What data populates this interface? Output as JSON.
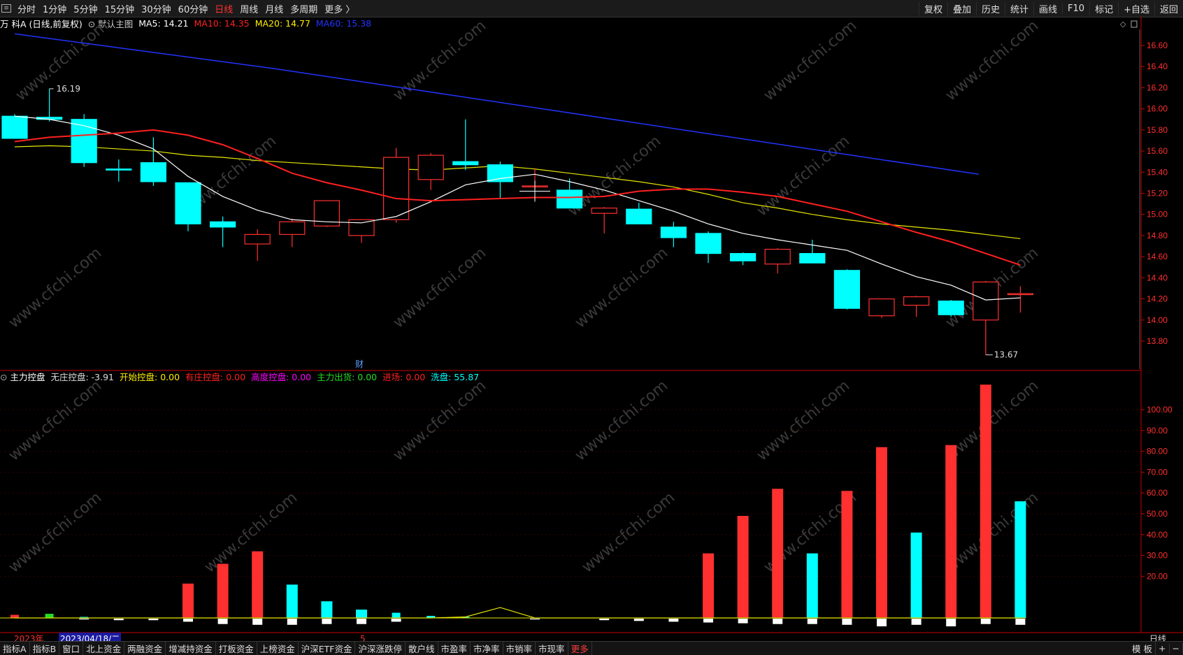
{
  "toolbar": {
    "periods": [
      "分时",
      "1分钟",
      "5分钟",
      "15分钟",
      "30分钟",
      "60分钟",
      "日线",
      "周线",
      "月线",
      "多周期",
      "更多 〉"
    ],
    "selected_period": "日线",
    "right_buttons": [
      "复权",
      "叠加",
      "历史",
      "统计",
      "画线",
      "F10",
      "标记",
      "+自选",
      "返回"
    ]
  },
  "main_header": {
    "stock": "万 科A (日线,前复权)",
    "main_chart": "默认主图",
    "ma": [
      {
        "label": "MA5: 14.21",
        "color": "#ffffff"
      },
      {
        "label": "MA10: 14.35",
        "color": "#ff2020"
      },
      {
        "label": "MA20: 14.77",
        "color": "#ffee00"
      },
      {
        "label": "MA60: 15.38",
        "color": "#2233ff"
      }
    ]
  },
  "sub_header": {
    "name": "主力控盘",
    "items": [
      {
        "label": "无庄控盘: -3.91",
        "color": "#dddddd"
      },
      {
        "label": "开始控盘: 0.00",
        "color": "#ffee00"
      },
      {
        "label": "有庄控盘: 0.00",
        "color": "#ff2020"
      },
      {
        "label": "高度控盘: 0.00",
        "color": "#ff00ff"
      },
      {
        "label": "主力出货: 0.00",
        "color": "#22dd22"
      },
      {
        "label": "进场: 0.00",
        "color": "#ff2020"
      },
      {
        "label": "洗盘: 55.87",
        "color": "#00ffff"
      }
    ]
  },
  "price_axis": [
    16.6,
    16.4,
    16.2,
    16.0,
    15.8,
    15.6,
    15.4,
    15.2,
    15.0,
    14.8,
    14.6,
    14.4,
    14.2,
    14.0,
    13.8
  ],
  "indicator_axis": [
    100,
    90,
    80,
    70,
    60,
    50,
    40,
    30,
    20
  ],
  "annotations": {
    "high_label": "16.19",
    "low_label": "13.67",
    "fin_label": "财",
    "month_mark": "5"
  },
  "dates": {
    "year": "2023年",
    "cursor_date": "2023/04/18/二",
    "right": "日线"
  },
  "bottom_tabs": [
    "指标A",
    "指标B",
    "窗口",
    "北上资金",
    "两融资金",
    "增减持资金",
    "打板资金",
    "上榜资金",
    "沪深ETF资金",
    "沪深涨跌停",
    "散户线",
    "市盈率",
    "市净率",
    "市销率",
    "市现率",
    "更多"
  ],
  "bottom_right": [
    "模 板",
    "+",
    "−"
  ],
  "watermark": "www.cfchi.com",
  "colors": {
    "up": "#ff3030",
    "down": "#00ffff",
    "ma5": "#ffffff",
    "ma10": "#ff2020",
    "ma20": "#e6e600",
    "ma60": "#2233ff",
    "frame": "#cc0000"
  },
  "chart_data": {
    "type": "candlestick",
    "candles": [
      {
        "o": 15.93,
        "h": 15.95,
        "l": 15.75,
        "c": 15.72
      },
      {
        "o": 15.92,
        "h": 16.19,
        "l": 15.88,
        "c": 15.9
      },
      {
        "o": 15.9,
        "h": 15.95,
        "l": 15.45,
        "c": 15.49
      },
      {
        "o": 15.43,
        "h": 15.52,
        "l": 15.31,
        "c": 15.42
      },
      {
        "o": 15.49,
        "h": 15.73,
        "l": 15.27,
        "c": 15.31
      },
      {
        "o": 15.3,
        "h": 15.3,
        "l": 14.84,
        "c": 14.91
      },
      {
        "o": 14.93,
        "h": 14.98,
        "l": 14.69,
        "c": 14.88
      },
      {
        "o": 14.72,
        "h": 14.86,
        "l": 14.56,
        "c": 14.81
      },
      {
        "o": 14.81,
        "h": 14.96,
        "l": 14.69,
        "c": 14.93
      },
      {
        "o": 14.89,
        "h": 15.13,
        "l": 14.88,
        "c": 15.13
      },
      {
        "o": 14.8,
        "h": 14.95,
        "l": 14.73,
        "c": 14.95
      },
      {
        "o": 14.95,
        "h": 15.63,
        "l": 14.92,
        "c": 15.54
      },
      {
        "o": 15.33,
        "h": 15.58,
        "l": 15.23,
        "c": 15.56
      },
      {
        "o": 15.5,
        "h": 15.9,
        "l": 15.42,
        "c": 15.47
      },
      {
        "o": 15.47,
        "h": 15.5,
        "l": 15.15,
        "c": 15.31
      },
      {
        "o": 15.27,
        "h": 15.43,
        "l": 15.24,
        "c": 15.27
      },
      {
        "o": 15.23,
        "h": 15.34,
        "l": 15.06,
        "c": 15.06
      },
      {
        "o": 15.01,
        "h": 15.07,
        "l": 14.82,
        "c": 15.06
      },
      {
        "o": 15.05,
        "h": 15.11,
        "l": 14.91,
        "c": 14.91
      },
      {
        "o": 14.88,
        "h": 14.93,
        "l": 14.69,
        "c": 14.78
      },
      {
        "o": 14.82,
        "h": 14.84,
        "l": 14.54,
        "c": 14.63
      },
      {
        "o": 14.63,
        "h": 14.64,
        "l": 14.52,
        "c": 14.56
      },
      {
        "o": 14.53,
        "h": 14.68,
        "l": 14.44,
        "c": 14.67
      },
      {
        "o": 14.63,
        "h": 14.76,
        "l": 14.55,
        "c": 14.54
      },
      {
        "o": 14.47,
        "h": 14.48,
        "l": 14.1,
        "c": 14.11
      },
      {
        "o": 14.04,
        "h": 14.2,
        "l": 14.02,
        "c": 14.2
      },
      {
        "o": 14.14,
        "h": 14.23,
        "l": 14.03,
        "c": 14.22
      },
      {
        "o": 14.18,
        "h": 14.19,
        "l": 14.03,
        "c": 14.05
      },
      {
        "o": 14.0,
        "h": 14.37,
        "l": 13.67,
        "c": 14.36
      },
      {
        "o": 14.25,
        "h": 14.32,
        "l": 14.07,
        "c": 14.25
      }
    ],
    "ma5": [
      15.93,
      15.9,
      15.84,
      15.75,
      15.62,
      15.36,
      15.17,
      15.04,
      14.95,
      14.93,
      14.92,
      14.98,
      15.12,
      15.28,
      15.34,
      15.38,
      15.31,
      15.23,
      15.13,
      15.03,
      14.91,
      14.82,
      14.76,
      14.71,
      14.66,
      14.53,
      14.41,
      14.33,
      14.19,
      14.21
    ],
    "ma10": [
      15.69,
      15.73,
      15.75,
      15.77,
      15.8,
      15.75,
      15.66,
      15.53,
      15.39,
      15.3,
      15.23,
      15.15,
      15.13,
      15.14,
      15.15,
      15.16,
      15.16,
      15.17,
      15.22,
      15.24,
      15.24,
      15.21,
      15.17,
      15.1,
      15.03,
      14.93,
      14.83,
      14.74,
      14.63,
      14.52,
      14.45,
      14.35
    ],
    "ma20": [
      15.64,
      15.65,
      15.64,
      15.62,
      15.6,
      15.56,
      15.54,
      15.51,
      15.49,
      15.47,
      15.45,
      15.43,
      15.42,
      15.44,
      15.46,
      15.43,
      15.39,
      15.35,
      15.31,
      15.26,
      15.19,
      15.11,
      15.06,
      15.0,
      14.95,
      14.91,
      14.88,
      14.85,
      14.81,
      14.77
    ],
    "ma60": [
      16.71,
      16.38,
      15.38
    ],
    "indicator": {
      "zero_line": [
        0,
        0,
        0,
        0,
        0,
        0,
        0,
        0,
        0,
        0,
        0,
        0,
        0,
        0,
        0,
        0,
        0,
        0,
        0,
        0,
        0,
        0,
        0,
        0,
        0,
        0,
        0,
        0,
        0,
        0
      ],
      "yellow_line": [
        0,
        0,
        0,
        0,
        0,
        0,
        0,
        0,
        0,
        0,
        0,
        0,
        0,
        0.5,
        5,
        0,
        0,
        0,
        0,
        0,
        0,
        0,
        0,
        0,
        0,
        0,
        0,
        0,
        0,
        0
      ],
      "bars": [
        {
          "v": 1.5,
          "c": "up"
        },
        {
          "v": 2,
          "c": "green"
        },
        {
          "v": 0.5,
          "c": "down"
        },
        {
          "v": 0,
          "c": "down"
        },
        {
          "v": 0,
          "c": "down"
        },
        {
          "v": 16.5,
          "c": "up"
        },
        {
          "v": 26,
          "c": "up"
        },
        {
          "v": 32,
          "c": "up"
        },
        {
          "v": 16,
          "c": "down"
        },
        {
          "v": 8,
          "c": "down"
        },
        {
          "v": 4,
          "c": "down"
        },
        {
          "v": 2.5,
          "c": "down"
        },
        {
          "v": 1,
          "c": "down"
        },
        {
          "v": 0.5,
          "c": "down"
        },
        {
          "v": 0,
          "c": "down"
        },
        {
          "v": 0,
          "c": "down"
        },
        {
          "v": 0,
          "c": "down"
        },
        {
          "v": 0,
          "c": "down"
        },
        {
          "v": 0,
          "c": "down"
        },
        {
          "v": 0,
          "c": "down"
        },
        {
          "v": 31,
          "c": "up"
        },
        {
          "v": 49,
          "c": "up"
        },
        {
          "v": 62,
          "c": "up"
        },
        {
          "v": 31,
          "c": "down"
        },
        {
          "v": 61,
          "c": "up"
        },
        {
          "v": 82,
          "c": "up"
        },
        {
          "v": 41,
          "c": "down"
        },
        {
          "v": 83,
          "c": "up"
        },
        {
          "v": 112,
          "c": "up"
        },
        {
          "v": 56,
          "c": "down"
        }
      ],
      "neg_bars": [
        0,
        0,
        0.5,
        1,
        1,
        2,
        3.5,
        4,
        4,
        3.5,
        3.5,
        2,
        0,
        0,
        0,
        0.5,
        0,
        1,
        1.5,
        2,
        2.5,
        3,
        3.5,
        3.5,
        4,
        5,
        4,
        5,
        3.5,
        4
      ]
    }
  }
}
